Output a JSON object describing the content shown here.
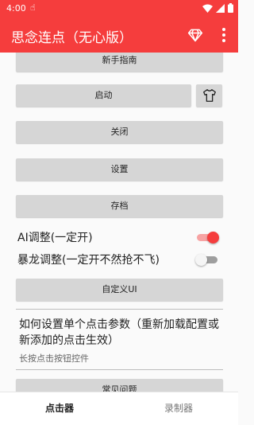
{
  "status_bar": {
    "time": "4:00"
  },
  "app_bar": {
    "title": "思念连点（无心版）"
  },
  "buttons": {
    "guide": "新手指南",
    "start": "启动",
    "close": "关闭",
    "settings": "设置",
    "save": "存档",
    "custom_ui": "自定义UI",
    "faq": "常见问题"
  },
  "toggles": {
    "ai_adjust": {
      "label": "AI调整(一定开)",
      "on": true
    },
    "dragon_adjust": {
      "label": "暴龙调整(一定开不然抢不飞)",
      "on": false
    }
  },
  "help": {
    "title": "如何设置单个点击参数（重新加载配置或新添加的点击生效）",
    "subtitle": "长按点击按钮控件"
  },
  "bottom_nav": {
    "tabs": [
      "点击器",
      "录制器"
    ],
    "active_index": 0
  },
  "colors": {
    "accent": "#f53d3d",
    "button_bg": "#d6d6d6"
  }
}
